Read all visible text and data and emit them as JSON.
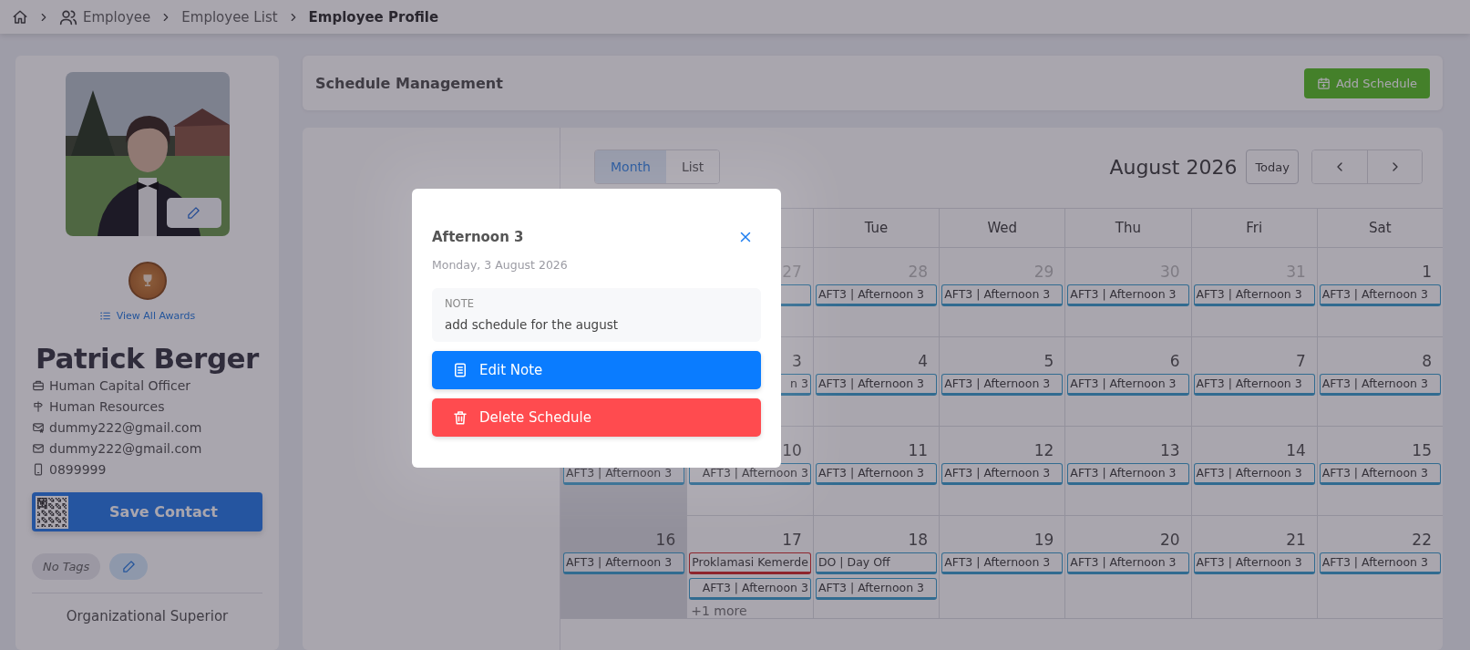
{
  "breadcrumb": {
    "items": [
      {
        "label": "Employee",
        "current": false
      },
      {
        "label": "Employee List",
        "current": false
      },
      {
        "label": "Employee Profile",
        "current": true
      }
    ]
  },
  "profile": {
    "awards_link": "View All Awards",
    "name": "Patrick Berger",
    "details": [
      {
        "kind": "job",
        "text": "Human Capital Officer"
      },
      {
        "kind": "department",
        "text": "Human Resources"
      },
      {
        "kind": "work_email",
        "text": "dummy222@gmail.com"
      },
      {
        "kind": "email",
        "text": "dummy222@gmail.com"
      },
      {
        "kind": "phone",
        "text": "0899999"
      }
    ],
    "save_contact": "Save Contact",
    "tags_empty": "No Tags",
    "section_heading": "Organizational Superior"
  },
  "schedule": {
    "title": "Schedule Management",
    "add_button": "Add Schedule"
  },
  "calendar": {
    "views": [
      {
        "label": "Month",
        "selected": true
      },
      {
        "label": "List",
        "selected": false
      }
    ],
    "title": "August 2026",
    "today": "Today",
    "weekdays": [
      "Tue",
      "Wed",
      "Thu",
      "Fri",
      "Sat"
    ],
    "weeks": [
      [
        {
          "date": "27",
          "muted": true,
          "shaded": false,
          "events": [
            {
              "kind": "shift"
            }
          ]
        },
        {
          "date": "28",
          "muted": true,
          "shaded": false,
          "events": [
            {
              "kind": "shift",
              "label": "AFT3 | Afternoon 3"
            }
          ]
        },
        {
          "date": "29",
          "muted": true,
          "shaded": false,
          "events": [
            {
              "kind": "shift",
              "label": "AFT3 | Afternoon 3"
            }
          ]
        },
        {
          "date": "30",
          "muted": true,
          "shaded": false,
          "events": [
            {
              "kind": "shift",
              "label": "AFT3 | Afternoon 3"
            }
          ]
        },
        {
          "date": "31",
          "muted": true,
          "shaded": false,
          "events": [
            {
              "kind": "shift",
              "label": "AFT3 | Afternoon 3"
            }
          ]
        },
        {
          "date": "1",
          "muted": false,
          "shaded": false,
          "events": [
            {
              "kind": "shift",
              "label": "AFT3 | Afternoon 3"
            }
          ]
        }
      ],
      [
        {
          "date": "3",
          "muted": false,
          "shaded": false,
          "events": [
            {
              "kind": "shift",
              "label": "n 3"
            }
          ]
        },
        {
          "date": "4",
          "muted": false,
          "shaded": false,
          "events": [
            {
              "kind": "shift",
              "label": "AFT3 | Afternoon 3"
            }
          ]
        },
        {
          "date": "5",
          "muted": false,
          "shaded": false,
          "events": [
            {
              "kind": "shift",
              "label": "AFT3 | Afternoon 3"
            }
          ]
        },
        {
          "date": "6",
          "muted": false,
          "shaded": false,
          "events": [
            {
              "kind": "shift",
              "label": "AFT3 | Afternoon 3"
            }
          ]
        },
        {
          "date": "7",
          "muted": false,
          "shaded": false,
          "events": [
            {
              "kind": "shift",
              "label": "AFT3 | Afternoon 3"
            }
          ]
        },
        {
          "date": "8",
          "muted": false,
          "shaded": false,
          "events": [
            {
              "kind": "shift",
              "label": "AFT3 | Afternoon 3"
            }
          ]
        }
      ],
      [
        {
          "shaded": true,
          "events": [
            {
              "kind": "shift",
              "label": "AFT3 | Afternoon 3"
            }
          ]
        },
        {
          "date": "10",
          "muted": false,
          "shaded": false,
          "events": [
            {
              "kind": "shift",
              "label": "AFT3 | Afternoon 3"
            }
          ]
        },
        {
          "date": "11",
          "muted": false,
          "shaded": false,
          "events": [
            {
              "kind": "shift",
              "label": "AFT3 | Afternoon 3"
            }
          ]
        },
        {
          "date": "12",
          "muted": false,
          "shaded": false,
          "events": [
            {
              "kind": "shift",
              "label": "AFT3 | Afternoon 3"
            }
          ]
        },
        {
          "date": "13",
          "muted": false,
          "shaded": false,
          "events": [
            {
              "kind": "shift",
              "label": "AFT3 | Afternoon 3"
            }
          ]
        },
        {
          "date": "14",
          "muted": false,
          "shaded": false,
          "events": [
            {
              "kind": "shift",
              "label": "AFT3 | Afternoon 3"
            }
          ]
        },
        {
          "date": "15",
          "muted": false,
          "shaded": false,
          "events": [
            {
              "kind": "shift",
              "label": "AFT3 | Afternoon 3"
            }
          ]
        }
      ],
      [
        {
          "date": "16",
          "muted": false,
          "shaded": true,
          "events": [
            {
              "kind": "shift",
              "label": "AFT3 | Afternoon 3"
            }
          ]
        },
        {
          "date": "17",
          "muted": false,
          "shaded": false,
          "events": [
            {
              "kind": "holiday",
              "label": "Proklamasi Kemerde"
            },
            {
              "kind": "shift",
              "label": "AFT3 | Afternoon 3"
            }
          ],
          "more": "+1 more"
        },
        {
          "date": "18",
          "muted": false,
          "shaded": false,
          "events": [
            {
              "kind": "shift",
              "label": "DO | Day Off"
            },
            {
              "kind": "shift",
              "label": "AFT3 | Afternoon 3"
            }
          ]
        },
        {
          "date": "19",
          "muted": false,
          "shaded": false,
          "events": [
            {
              "kind": "shift",
              "label": "AFT3 | Afternoon 3"
            }
          ]
        },
        {
          "date": "20",
          "muted": false,
          "shaded": false,
          "events": [
            {
              "kind": "shift",
              "label": "AFT3 | Afternoon 3"
            }
          ]
        },
        {
          "date": "21",
          "muted": false,
          "shaded": false,
          "events": [
            {
              "kind": "shift",
              "label": "AFT3 | Afternoon 3"
            }
          ]
        },
        {
          "date": "22",
          "muted": false,
          "shaded": false,
          "events": [
            {
              "kind": "shift",
              "label": "AFT3 | Afternoon 3"
            }
          ]
        }
      ]
    ]
  },
  "modal": {
    "title": "Afternoon 3",
    "date": "Monday, 3 August 2026",
    "note_label": "NOTE",
    "note": "add schedule for the august",
    "edit_button": "Edit Note",
    "delete_button": "Delete Schedule"
  }
}
